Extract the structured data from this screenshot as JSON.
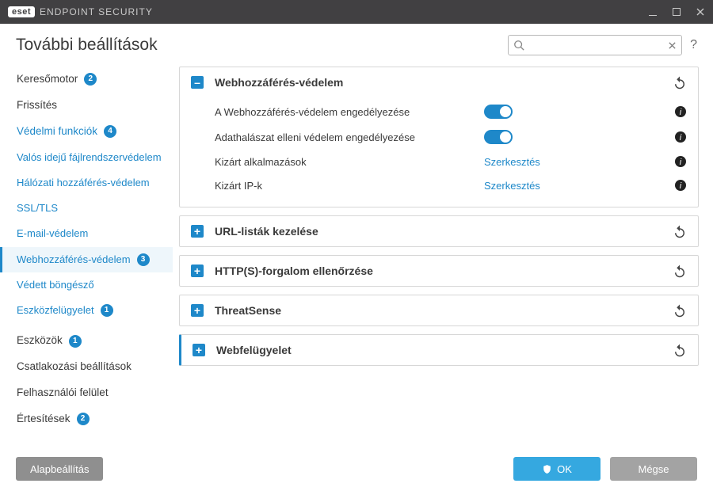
{
  "titlebar": {
    "brand": "eset",
    "product": "ENDPOINT SECURITY"
  },
  "header": {
    "title": "További beállítások",
    "search_placeholder": ""
  },
  "sidebar": {
    "items": [
      {
        "label": "Keresőmotor",
        "badge": "2",
        "type": "top"
      },
      {
        "label": "Frissítés",
        "type": "top"
      },
      {
        "label": "Védelmi funkciók",
        "badge": "4",
        "type": "top link"
      },
      {
        "label": "Valós idejű fájlrendszervédelem",
        "type": "sub link"
      },
      {
        "label": "Hálózati hozzáférés-védelem",
        "type": "sub link"
      },
      {
        "label": "SSL/TLS",
        "type": "sub link"
      },
      {
        "label": "E-mail-védelem",
        "type": "sub link"
      },
      {
        "label": "Webhozzáférés-védelem",
        "badge": "3",
        "type": "sub link active"
      },
      {
        "label": "Védett böngésző",
        "type": "sub link"
      },
      {
        "label": "Eszközfelügyelet",
        "badge": "1",
        "type": "sub link"
      },
      {
        "label": "Eszközök",
        "badge": "1",
        "type": "top"
      },
      {
        "label": "Csatlakozási beállítások",
        "type": "top"
      },
      {
        "label": "Felhasználói felület",
        "type": "top"
      },
      {
        "label": "Értesítések",
        "badge": "2",
        "type": "top"
      }
    ]
  },
  "panels": {
    "web": {
      "title": "Webhozzáférés-védelem",
      "rows": [
        {
          "label": "A Webhozzáférés-védelem engedélyezése",
          "control": "toggle"
        },
        {
          "label": "Adathalászat elleni védelem engedélyezése",
          "control": "toggle"
        },
        {
          "label": "Kizárt alkalmazások",
          "control": "link",
          "link_text": "Szerkesztés"
        },
        {
          "label": "Kizárt IP-k",
          "control": "link",
          "link_text": "Szerkesztés"
        }
      ]
    },
    "url": {
      "title": "URL-listák kezelése"
    },
    "https": {
      "title": "HTTP(S)-forgalom ellenőrzése"
    },
    "ts": {
      "title": "ThreatSense"
    },
    "wmon": {
      "title": "Webfelügyelet"
    }
  },
  "footer": {
    "default_btn": "Alapbeállítás",
    "ok": "OK",
    "cancel": "Mégse"
  },
  "icons": {
    "expand_minus": "–",
    "expand_plus": "+",
    "help": "?"
  }
}
